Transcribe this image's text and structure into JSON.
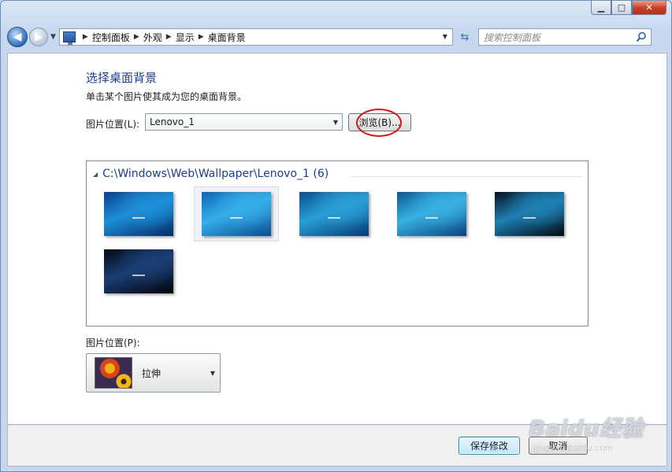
{
  "window": {
    "caption": {
      "minimize": "▁",
      "maximize": "□",
      "close": "✕"
    }
  },
  "nav": {
    "back_icon": "arrow-left-icon",
    "forward_icon": "arrow-right-icon",
    "breadcrumbs": [
      "控制面板",
      "外观",
      "显示",
      "桌面背景"
    ],
    "search_placeholder": "搜索控制面板"
  },
  "main": {
    "title": "选择桌面背景",
    "subtitle": "单击某个图片使其成为您的桌面背景。",
    "location_label": "图片位置(L):",
    "location_value": "Lenovo_1",
    "browse_label": "浏览(B)...",
    "gallery": {
      "group_path": "C:\\Windows\\Web\\Wallpaper\\Lenovo_1 (6)",
      "thumbnails": [
        {
          "name": "lenovo-wallpaper-1",
          "selected": false,
          "colors": [
            "#0a3f8e",
            "#1d8fd8",
            "#052a66"
          ]
        },
        {
          "name": "lenovo-wallpaper-2",
          "selected": true,
          "colors": [
            "#0b66b5",
            "#35aee8",
            "#0a4d93"
          ]
        },
        {
          "name": "lenovo-wallpaper-3",
          "selected": false,
          "colors": [
            "#0b4f8e",
            "#2a9ed6",
            "#063a72"
          ]
        },
        {
          "name": "lenovo-wallpaper-4",
          "selected": false,
          "colors": [
            "#0c5a96",
            "#39b0e0",
            "#08447f"
          ]
        },
        {
          "name": "lenovo-wallpaper-5",
          "selected": false,
          "colors": [
            "#03121f",
            "#1f7fb3",
            "#010a12"
          ]
        },
        {
          "name": "lenovo-wallpaper-6",
          "selected": false,
          "colors": [
            "#020814",
            "#1a3e74",
            "#010409"
          ]
        }
      ]
    },
    "position_label": "图片位置(P):",
    "position_value": "拉伸"
  },
  "footer": {
    "save_label": "保存修改",
    "cancel_label": "取消"
  },
  "watermark": {
    "brand": "Baidu经验",
    "url": "jingyan.baidu.com"
  }
}
